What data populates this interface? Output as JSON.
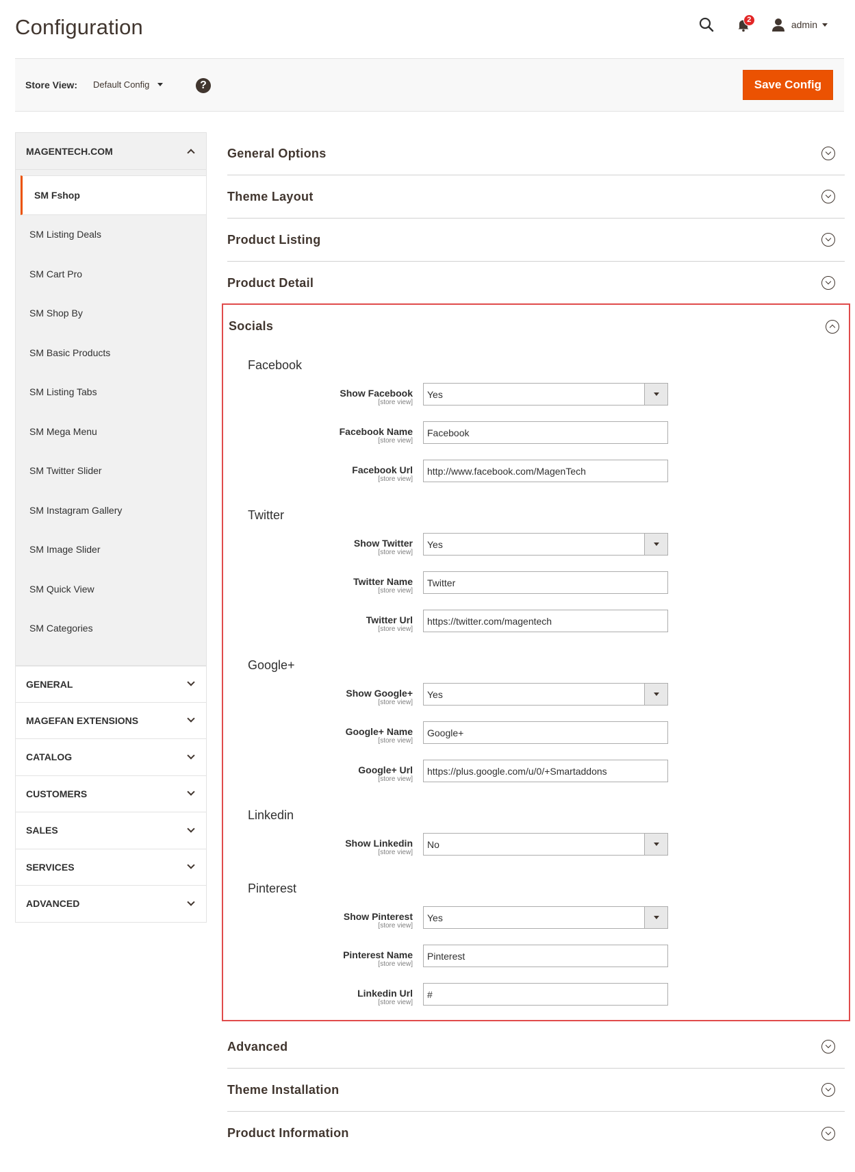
{
  "page": {
    "title": "Configuration"
  },
  "header": {
    "notification_count": "2",
    "user": "admin"
  },
  "store_bar": {
    "label": "Store View:",
    "value": "Default Config",
    "help": "?",
    "save_label": "Save Config"
  },
  "sidebar": {
    "section_title": "MAGENTECH.COM",
    "items": [
      "SM Fshop",
      "SM Listing Deals",
      "SM Cart Pro",
      "SM Shop By",
      "SM Basic Products",
      "SM Listing Tabs",
      "SM Mega Menu",
      "SM Twitter Slider",
      "SM Instagram Gallery",
      "SM Image Slider",
      "SM Quick View",
      "SM Categories"
    ],
    "groups": [
      "GENERAL",
      "MAGEFAN EXTENSIONS",
      "CATALOG",
      "CUSTOMERS",
      "SALES",
      "SERVICES",
      "ADVANCED"
    ]
  },
  "main": {
    "sections_top": [
      "General Options",
      "Theme Layout",
      "Product Listing",
      "Product Detail"
    ],
    "socials": {
      "title": "Socials",
      "scope": "[store view]",
      "groups": [
        {
          "title": "Facebook",
          "fields": [
            {
              "label": "Show Facebook",
              "value": "Yes"
            },
            {
              "label": "Facebook Name",
              "value": "Facebook"
            },
            {
              "label": "Facebook Url",
              "value": "http://www.facebook.com/MagenTech"
            }
          ]
        },
        {
          "title": "Twitter",
          "fields": [
            {
              "label": "Show Twitter",
              "value": "Yes"
            },
            {
              "label": "Twitter Name",
              "value": "Twitter"
            },
            {
              "label": "Twitter Url",
              "value": "https://twitter.com/magentech"
            }
          ]
        },
        {
          "title": "Google+",
          "fields": [
            {
              "label": "Show Google+",
              "value": "Yes"
            },
            {
              "label": "Google+ Name",
              "value": "Google+"
            },
            {
              "label": "Google+ Url",
              "value": "https://plus.google.com/u/0/+Smartaddons"
            }
          ]
        },
        {
          "title": "Linkedin",
          "fields": [
            {
              "label": "Show Linkedin",
              "value": "No"
            }
          ]
        },
        {
          "title": "Pinterest",
          "fields": [
            {
              "label": "Show Pinterest",
              "value": "Yes"
            },
            {
              "label": "Pinterest Name",
              "value": "Pinterest"
            },
            {
              "label": "Linkedin Url",
              "value": "#"
            }
          ]
        }
      ]
    },
    "sections_bottom": [
      "Advanced",
      "Theme Installation",
      "Product Information"
    ]
  },
  "colors": {
    "accent": "#eb5202",
    "highlight_border": "#e04b4b",
    "badge": "#e22626"
  }
}
